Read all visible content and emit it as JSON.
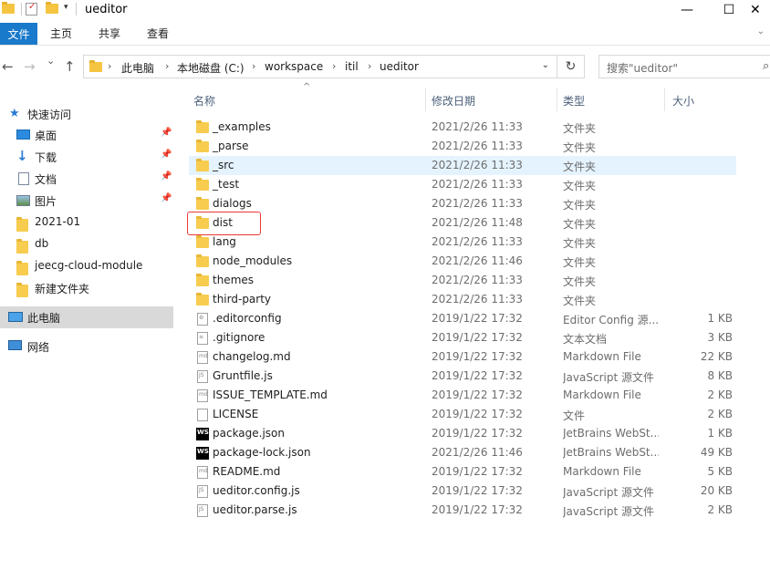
{
  "window": {
    "title": "ueditor",
    "minimize": "—",
    "maximize": "☐",
    "close": "✕"
  },
  "ribbon": {
    "file": "文件",
    "tabs": [
      "主页",
      "共享",
      "查看"
    ],
    "expand_icon": "chevron-down-icon"
  },
  "nav": {
    "back": "←",
    "forward": "→",
    "recent": "⌄",
    "up": "↑",
    "breadcrumbs": [
      "此电脑",
      "本地磁盘 (C:)",
      "workspace",
      "itil",
      "ueditor"
    ],
    "refresh": "↻",
    "search_placeholder": "搜索\"ueditor\""
  },
  "sidebar": {
    "items": [
      {
        "label": "快速访问",
        "icon": "star-icon"
      },
      {
        "label": "桌面",
        "icon": "desktop-icon",
        "pinned": true
      },
      {
        "label": "下载",
        "icon": "download-icon",
        "pinned": true
      },
      {
        "label": "文档",
        "icon": "document-icon",
        "pinned": true
      },
      {
        "label": "图片",
        "icon": "picture-icon",
        "pinned": true
      },
      {
        "label": "2021-01",
        "icon": "folder-icon"
      },
      {
        "label": "db",
        "icon": "folder-icon"
      },
      {
        "label": "jeecg-cloud-module",
        "icon": "folder-icon"
      },
      {
        "label": "新建文件夹",
        "icon": "folder-icon"
      },
      {
        "label": "此电脑",
        "icon": "computer-icon",
        "selected": true
      },
      {
        "label": "网络",
        "icon": "network-icon"
      }
    ]
  },
  "columns": {
    "name": "名称",
    "date": "修改日期",
    "type": "类型",
    "size": "大小"
  },
  "files": [
    {
      "name": "_examples",
      "date": "2021/2/26 11:33",
      "type": "文件夹",
      "size": "",
      "icon": "folder"
    },
    {
      "name": "_parse",
      "date": "2021/2/26 11:33",
      "type": "文件夹",
      "size": "",
      "icon": "folder"
    },
    {
      "name": "_src",
      "date": "2021/2/26 11:33",
      "type": "文件夹",
      "size": "",
      "icon": "folder"
    },
    {
      "name": "_test",
      "date": "2021/2/26 11:33",
      "type": "文件夹",
      "size": "",
      "icon": "folder"
    },
    {
      "name": "dialogs",
      "date": "2021/2/26 11:33",
      "type": "文件夹",
      "size": "",
      "icon": "folder"
    },
    {
      "name": "dist",
      "date": "2021/2/26 11:48",
      "type": "文件夹",
      "size": "",
      "icon": "folder"
    },
    {
      "name": "lang",
      "date": "2021/2/26 11:33",
      "type": "文件夹",
      "size": "",
      "icon": "folder"
    },
    {
      "name": "node_modules",
      "date": "2021/2/26 11:46",
      "type": "文件夹",
      "size": "",
      "icon": "folder"
    },
    {
      "name": "themes",
      "date": "2021/2/26 11:33",
      "type": "文件夹",
      "size": "",
      "icon": "folder"
    },
    {
      "name": "third-party",
      "date": "2021/2/26 11:33",
      "type": "文件夹",
      "size": "",
      "icon": "folder"
    },
    {
      "name": ".editorconfig",
      "date": "2019/1/22 17:32",
      "type": "Editor Config 源...",
      "size": "1 KB",
      "icon": "config"
    },
    {
      "name": ".gitignore",
      "date": "2019/1/22 17:32",
      "type": "文本文档",
      "size": "3 KB",
      "icon": "text"
    },
    {
      "name": "changelog.md",
      "date": "2019/1/22 17:32",
      "type": "Markdown File",
      "size": "22 KB",
      "icon": "md"
    },
    {
      "name": "Gruntfile.js",
      "date": "2019/1/22 17:32",
      "type": "JavaScript 源文件",
      "size": "8 KB",
      "icon": "js"
    },
    {
      "name": "ISSUE_TEMPLATE.md",
      "date": "2019/1/22 17:32",
      "type": "Markdown File",
      "size": "2 KB",
      "icon": "md"
    },
    {
      "name": "LICENSE",
      "date": "2019/1/22 17:32",
      "type": "文件",
      "size": "2 KB",
      "icon": "blank"
    },
    {
      "name": "package.json",
      "date": "2019/1/22 17:32",
      "type": "JetBrains WebSt...",
      "size": "1 KB",
      "icon": "ws"
    },
    {
      "name": "package-lock.json",
      "date": "2021/2/26 11:46",
      "type": "JetBrains WebSt...",
      "size": "49 KB",
      "icon": "ws"
    },
    {
      "name": "README.md",
      "date": "2019/1/22 17:32",
      "type": "Markdown File",
      "size": "5 KB",
      "icon": "md"
    },
    {
      "name": "ueditor.config.js",
      "date": "2019/1/22 17:32",
      "type": "JavaScript 源文件",
      "size": "20 KB",
      "icon": "js"
    },
    {
      "name": "ueditor.parse.js",
      "date": "2019/1/22 17:32",
      "type": "JavaScript 源文件",
      "size": "2 KB",
      "icon": "js"
    }
  ],
  "hover_row": "_src",
  "annotated_row": "dist",
  "colors": {
    "accent": "#1979ca",
    "hover": "#e5f3ff",
    "selected": "#d9d9d9",
    "annotation": "#e53935",
    "folder": "#f7cc4f"
  }
}
